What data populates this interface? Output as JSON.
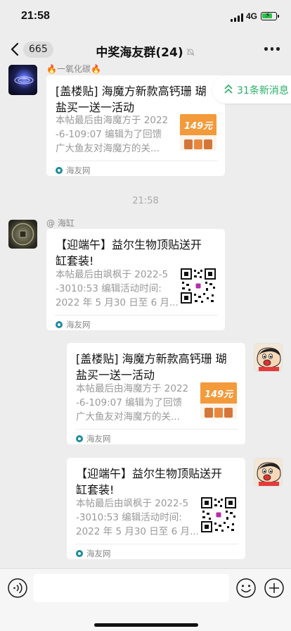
{
  "status_bar": {
    "time": "21:58",
    "network": "4G"
  },
  "nav": {
    "unread_count": "665",
    "title": "中奖海友群(24)"
  },
  "new_messages_pill": "31条新消息",
  "timestamp_divider": "21:58",
  "messages": [
    {
      "side": "left",
      "sender": "🔥一氧化碳🔥",
      "title_line1": "[盖楼贴] 海魔方新款高钙珊 瑚",
      "title_line2": "盐买一送一活动",
      "desc_line1": "本帖最后由海魔方于 2022",
      "desc_line2": "-6-109:07 编辑为了回馈",
      "desc_line3": "广大鱼友对海魔方的关...",
      "thumb_text": "149元",
      "source": "海友网"
    },
    {
      "side": "left",
      "sender": "@ 海缸",
      "title_line1": "【迎端午】益尔生物顶贴送开",
      "title_line2": "缸套装!",
      "desc_line1": "本帖最后由飒枫于 2022-5",
      "desc_line2": "-3010:53 编辑活动时间:",
      "desc_line3": "2022 年 5 月30 日至 6 月...",
      "source": "海友网"
    },
    {
      "side": "right",
      "title_line1": "[盖楼贴] 海魔方新款高钙珊 瑚",
      "title_line2": "盐买一送一活动",
      "desc_line1": "本帖最后由海魔方于 2022",
      "desc_line2": "-6-109:07 编辑为了回馈",
      "desc_line3": "广大鱼友对海魔方的关...",
      "thumb_text": "149元",
      "source": "海友网"
    },
    {
      "side": "right",
      "title_line1": "【迎端午】益尔生物顶贴送开",
      "title_line2": "缸套装!",
      "desc_line1": "本帖最后由飒枫于 2022-5",
      "desc_line2": "-3010:53 编辑活动时间:",
      "desc_line3": "2022 年 5 月30 日至 6 月...",
      "source": "海友网"
    }
  ],
  "input": {
    "value": "",
    "placeholder": ""
  },
  "colors": {
    "background": "#ededed",
    "accent_green": "#2aae67",
    "bubble": "#ffffff",
    "promo_orange": "#f39a3b"
  }
}
